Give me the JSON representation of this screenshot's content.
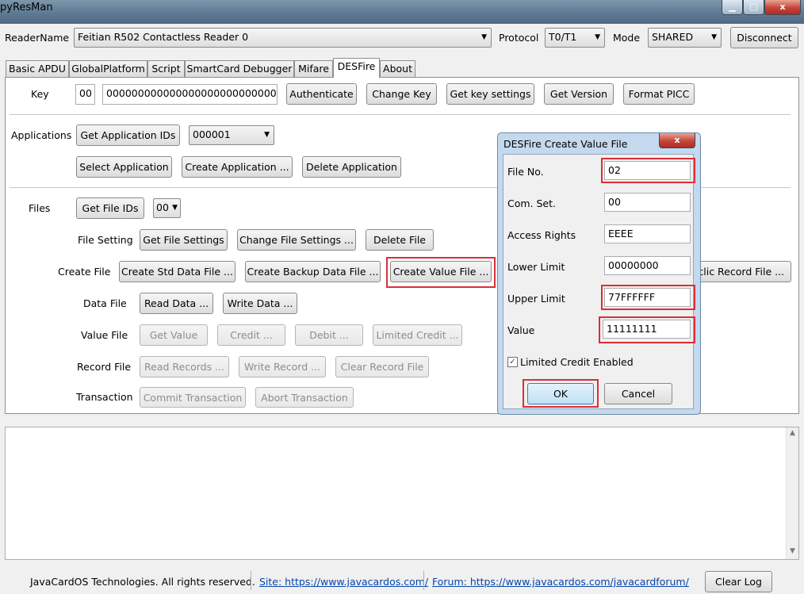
{
  "window": {
    "title": "pyResMan",
    "minimize": "▁",
    "maximize": "□",
    "close": "x"
  },
  "reader": {
    "label": "ReaderName",
    "value": "Feitian R502 Contactless Reader 0",
    "protocol_label": "Protocol",
    "protocol": "T0/T1",
    "mode_label": "Mode",
    "mode": "SHARED",
    "disconnect": "Disconnect"
  },
  "tabs": [
    "Basic APDU",
    "GlobalPlatform",
    "Script",
    "SmartCard Debugger",
    "Mifare",
    "DESFire",
    "About"
  ],
  "key": {
    "label": "Key",
    "number": "00",
    "value": "00000000000000000000000000000000",
    "authenticate": "Authenticate",
    "change_key": "Change Key",
    "get_key_settings": "Get key settings",
    "get_version": "Get Version",
    "format_picc": "Format PICC"
  },
  "applications": {
    "label": "Applications",
    "get_ids": "Get Application IDs",
    "selected": "000001",
    "select": "Select Application",
    "create": "Create Application ...",
    "delete": "Delete Application"
  },
  "files": {
    "label": "Files",
    "get_ids": "Get File IDs",
    "selected": "00",
    "file_setting_label": "File Setting",
    "get_settings": "Get File Settings",
    "change_settings": "Change File Settings ...",
    "delete": "Delete File",
    "create_label": "Create File",
    "create_std": "Create Std Data File ...",
    "create_backup": "Create Backup Data File ...",
    "create_value": "Create Value File ...",
    "create_cyclic": "yclic Record File ...",
    "data_label": "Data File",
    "read_data": "Read Data ...",
    "write_data": "Write Data ...",
    "value_label": "Value File",
    "get_value": "Get Value",
    "credit": "Credit ...",
    "debit": "Debit ...",
    "limited_credit": "Limited Credit ...",
    "record_label": "Record File",
    "read_records": "Read Records ...",
    "write_record": "Write Record ...",
    "clear_record": "Clear Record File",
    "transaction_label": "Transaction",
    "commit": "Commit Transaction",
    "abort": "Abort Transaction"
  },
  "dialog": {
    "title": "DESFire Create Value File",
    "close": "x",
    "file_no_label": "File No.",
    "file_no": "02",
    "com_set_label": "Com. Set.",
    "com_set": "00",
    "access_label": "Access Rights",
    "access": "EEEE",
    "lower_label": "Lower Limit",
    "lower": "00000000",
    "upper_label": "Upper Limit",
    "upper": "77FFFFFF",
    "value_label": "Value",
    "value": "11111111",
    "limited_credit_label": "Limited Credit Enabled",
    "ok": "OK",
    "cancel": "Cancel"
  },
  "footer": {
    "copyright": "JavaCardOS Technologies. All rights reserved.",
    "site": "Site: https://www.javacardos.com/",
    "forum": "Forum: https://www.javacardos.com/javacardforum/",
    "clear_log": "Clear Log"
  },
  "icons": {
    "combo_arrow": "▼",
    "scroll_up": "▲",
    "scroll_down": "▼",
    "check": "✓"
  },
  "colors": {
    "highlight": "#d93038",
    "ok_button": "#c9e4f7",
    "link": "#0645ad"
  }
}
